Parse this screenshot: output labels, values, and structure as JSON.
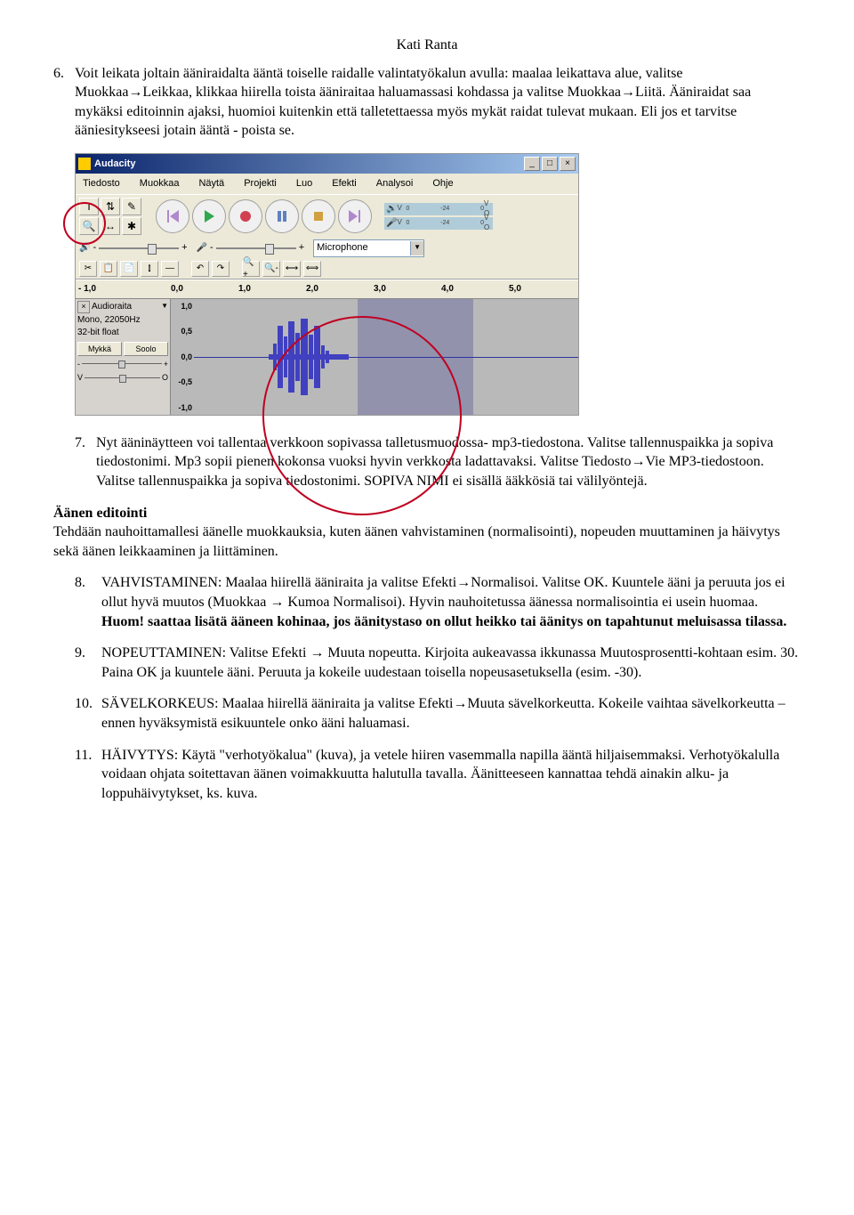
{
  "author": "Kati Ranta",
  "item6": {
    "num": "6.",
    "text": "Voit leikata joltain ääniraidalta ääntä toiselle raidalle valintatyökalun avulla: maalaa leikattava alue, valitse Muokkaa→Leikkaa, klikkaa hiirella toista ääniraitaa haluamassasi kohdassa ja valitse Muokkaa→Liitä. Ääniraidat saa mykäksi editoinnin ajaksi, huomioi kuitenkin että talletettaessa myös mykät raidat tulevat mukaan. Eli jos et tarvitse ääniesitykseesi jotain ääntä - poista se."
  },
  "audacity": {
    "title": "Audacity",
    "menus": [
      "Tiedosto",
      "Muokkaa",
      "Näytä",
      "Projekti",
      "Luo",
      "Efekti",
      "Analysoi",
      "Ohje"
    ],
    "tools": [
      "I",
      "⇅",
      "✎",
      "🔍",
      "↔",
      "✱"
    ],
    "inputDevice": "Microphone",
    "meterScale": [
      "0",
      "-24",
      "0"
    ],
    "rulerTicks": [
      "- 1,0",
      "0,0",
      "1,0",
      "2,0",
      "3,0",
      "4,0",
      "5,0"
    ],
    "track": {
      "name": "Audioraita",
      "mono": "Mono, 22050Hz",
      "bits": "32-bit float",
      "mute": "Mykkä",
      "solo": "Soolo",
      "panLeft": "V",
      "panRight": "O"
    },
    "ampScale": [
      "1,0",
      "0,5",
      "0,0",
      "-0,5",
      "-1,0"
    ]
  },
  "item7": {
    "num": "7.",
    "text": "Nyt ääninäytteen voi tallentaa verkkoon sopivassa talletusmuodossa- mp3-tiedostona. Valitse tallennuspaikka ja sopiva tiedostonimi. Mp3 sopii pienen kokonsa vuoksi hyvin verkkosta ladattavaksi. Valitse Tiedosto→Vie MP3-tiedostoon. Valitse tallennuspaikka ja sopiva tiedostonimi. SOPIVA NIMI ei sisällä ääkkösiä tai välilyöntejä."
  },
  "editHeading": "Äänen editointi",
  "editIntro": "Tehdään nauhoittamallesi äänelle muokkauksia, kuten äänen vahvistaminen (normalisointi), nopeuden muuttaminen ja häivytys sekä äänen leikkaaminen ja liittäminen.",
  "item8": {
    "num": "8.",
    "text": "VAHVISTAMINEN: Maalaa hiirellä ääniraita ja valitse Efekti→Normalisoi. Valitse OK. Kuuntele ääni ja peruuta jos ei ollut hyvä muutos (Muokkaa → Kumoa Normalisoi). Hyvin nauhoitetussa äänessa normalisointia ei usein huomaa. ",
    "bold": "Huom! saattaa lisätä ääneen kohinaa, jos äänitystaso on ollut heikko tai äänitys on tapahtunut meluisassa tilassa."
  },
  "item9": {
    "num": "9.",
    "text": "NOPEUTTAMINEN: Valitse Efekti → Muuta nopeutta. Kirjoita aukeavassa ikkunassa Muutosprosentti-kohtaan esim. 30. Paina OK ja kuuntele ääni. Peruuta ja kokeile uudestaan toisella nopeusasetuksella (esim. -30)."
  },
  "item10": {
    "num": "10.",
    "text": "SÄVELKORKEUS: Maalaa hiirellä ääniraita ja valitse Efekti→Muuta sävelkorkeutta. Kokeile vaihtaa sävelkorkeutta – ennen hyväksymistä esikuuntele onko ääni haluamasi."
  },
  "item11": {
    "num": "11.",
    "text": "HÄIVYTYS: Käytä \"verhotyökalua\" (kuva), ja vetele hiiren vasemmalla napilla ääntä hiljaisemmaksi. Verhotyökalulla voidaan ohjata soitettavan äänen voimakkuutta halutulla tavalla. Äänitteeseen kannattaa tehdä ainakin alku- ja loppuhäivytykset, ks. kuva."
  }
}
